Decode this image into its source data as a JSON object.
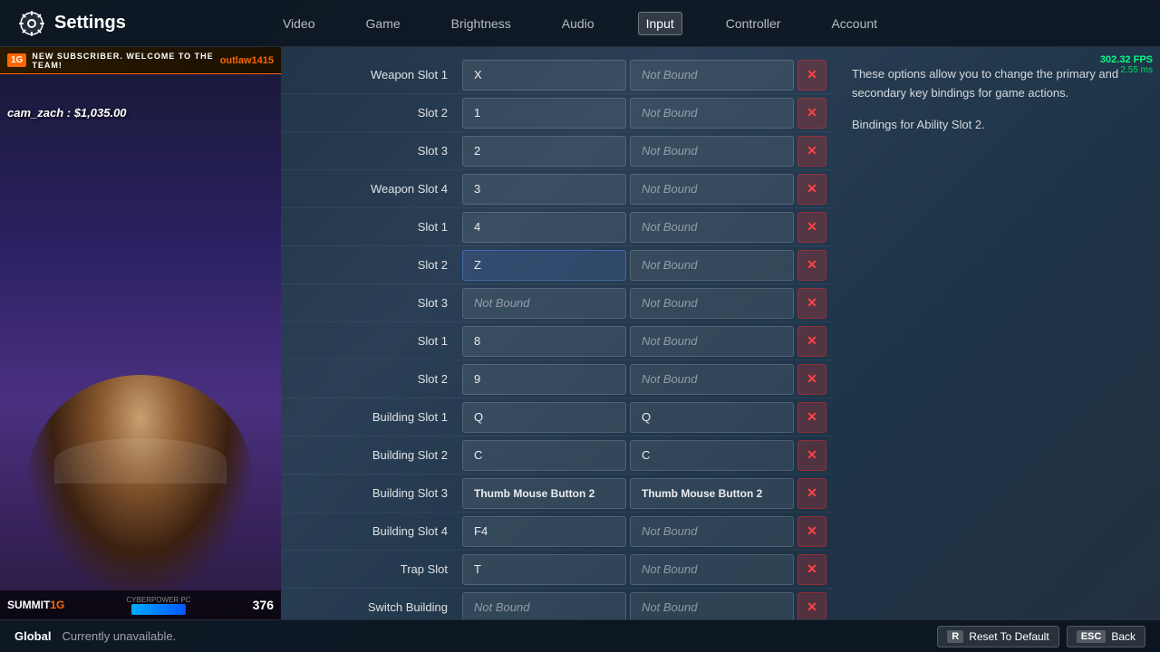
{
  "app": {
    "title": "Settings"
  },
  "nav": {
    "items": [
      {
        "label": "Video",
        "active": false
      },
      {
        "label": "Game",
        "active": false
      },
      {
        "label": "Brightness",
        "active": false
      },
      {
        "label": "Audio",
        "active": false
      },
      {
        "label": "Input",
        "active": true
      },
      {
        "label": "Controller",
        "active": false
      },
      {
        "label": "Account",
        "active": false
      }
    ]
  },
  "subscriber": {
    "badge": "1G",
    "text": "NEW SUBSCRIBER. WELCOME TO THE TEAM!",
    "username": "outlaw1415"
  },
  "cam": {
    "overlay_text": "cam_zach : $1,035.00",
    "logo": "SUMMIT",
    "logo_suffix": "1G",
    "sponsor": "CYBERPOWER PC",
    "score": "376"
  },
  "fps": {
    "value": "302.32 FPS",
    "ms": "2.55 ms"
  },
  "bindings": [
    {
      "label": "Weapon Slot 1",
      "primary": "X",
      "secondary": "Not Bound",
      "secondary_bound": false
    },
    {
      "label": "Slot 2",
      "primary": "1",
      "secondary": "Not Bound",
      "secondary_bound": false
    },
    {
      "label": "Slot 3",
      "primary": "2",
      "secondary": "Not Bound",
      "secondary_bound": false
    },
    {
      "label": "Weapon Slot 4",
      "primary": "3",
      "secondary": "Not Bound",
      "secondary_bound": false
    },
    {
      "label": "Slot 1",
      "primary": "4",
      "secondary": "Not Bound",
      "secondary_bound": false
    },
    {
      "label": "Slot 2",
      "primary": "Z",
      "secondary": "Not Bound",
      "secondary_bound": false
    },
    {
      "label": "Slot 3",
      "primary": "Not Bound",
      "secondary": "Not Bound",
      "primary_not_bound": true,
      "secondary_bound": false
    },
    {
      "label": "Slot 1",
      "primary": "8",
      "secondary": "Not Bound",
      "secondary_bound": false
    },
    {
      "label": "Slot 2",
      "primary": "9",
      "secondary": "Not Bound",
      "secondary_bound": false
    },
    {
      "label": "Building Slot 1",
      "primary": "Q",
      "secondary": "Q",
      "secondary_bound": true
    },
    {
      "label": "Building Slot 2",
      "primary": "C",
      "secondary": "C",
      "secondary_bound": true
    },
    {
      "label": "Building Slot 3",
      "primary": "Thumb Mouse Button 2",
      "secondary": "Thumb Mouse Button 2",
      "secondary_bound": true,
      "bold": true
    },
    {
      "label": "Building Slot 4",
      "primary": "F4",
      "secondary": "Not Bound",
      "secondary_bound": false
    },
    {
      "label": "Trap Slot",
      "primary": "T",
      "secondary": "Not Bound",
      "secondary_bound": false
    },
    {
      "label": "Switch Building",
      "primary": "Not Bound",
      "secondary": "Not Bound",
      "primary_not_bound": true,
      "secondary_bound": false
    }
  ],
  "info": {
    "main_text": "These options allow you to change the primary and secondary key bindings for game actions.",
    "sub_text": "Bindings for Ability Slot 2."
  },
  "bottom": {
    "global_label": "Global",
    "status": "Currently unavailable.",
    "reset_key": "R",
    "reset_label": "Reset To Default",
    "back_key": "ESC",
    "back_label": "Back"
  }
}
